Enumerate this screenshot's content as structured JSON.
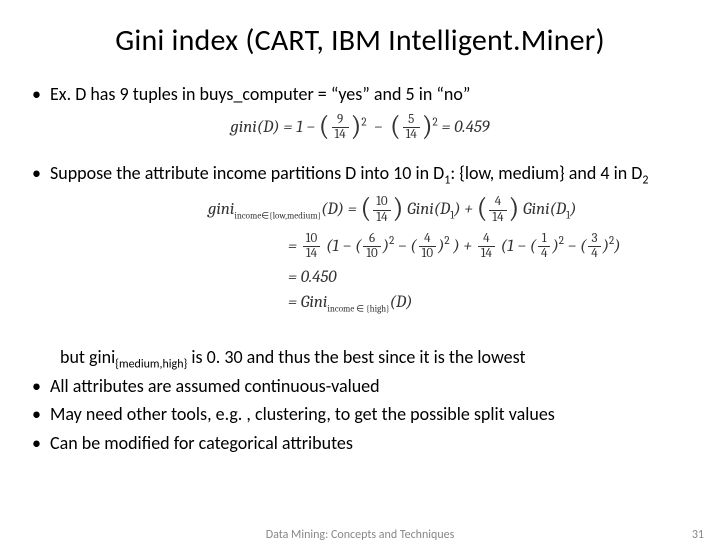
{
  "title": "Gini index (CART, IBM Intelligent.Miner)",
  "bullets": {
    "b1": "Ex.  D has 9 tuples in buys_computer = “yes” and 5 in “no”",
    "b2_pre": "Suppose the attribute income partitions D into 10 in D",
    "b2_sub1": "1",
    "b2_mid": ": {low, medium} and 4 in D",
    "b2_sub2": "2",
    "indent_pre": "but gini",
    "indent_sub": "{medium,high}",
    "indent_post": " is 0. 30 and thus the best since it is the lowest",
    "b3": "All attributes are assumed continuous-valued",
    "b4": "May need other tools, e.g. , clustering, to get the possible split values",
    "b5": "Can be modified for categorical attributes"
  },
  "formulas": {
    "f1_lhs": "gini(D) = 1 − ",
    "f1_t1_num": "9",
    "f1_t1_den": "14",
    "f1_t2_num": "5",
    "f1_t2_den": "14",
    "f1_eq": " = 0.459",
    "f2_lhs_pre": "gini",
    "f2_lhs_sub": "income∈{low,medium}",
    "f2_lhs_post": "(D) = ",
    "f2_a_num": "10",
    "f2_a_den": "14",
    "f2_mid1": "Gini(D",
    "f2_mid2": ") + ",
    "f2_b_num": "4",
    "f2_b_den": "14",
    "line2_pre": "= ",
    "line2_a_num": "10",
    "line2_a_den": "14",
    "line2_mid1": "(1 − (",
    "line2_t1_num": "6",
    "line2_t1_den": "10",
    "line2_sq": ")",
    "line2_mid2": " − (",
    "line2_t2_num": "4",
    "line2_t2_den": "10",
    "line2_mid3": ") + ",
    "line2_b_num": "4",
    "line2_b_den": "14",
    "line2_t3_num": "1",
    "line2_t3_den": "4",
    "line2_t4_num": "3",
    "line2_t4_den": "4",
    "line2_end": ")",
    "line3": "= 0.450",
    "line4_pre": "= Gini",
    "line4_sub": "income ∈ {high}",
    "line4_post": "(D)"
  },
  "footer": {
    "center": "Data Mining: Concepts and Techniques",
    "page": "31"
  }
}
